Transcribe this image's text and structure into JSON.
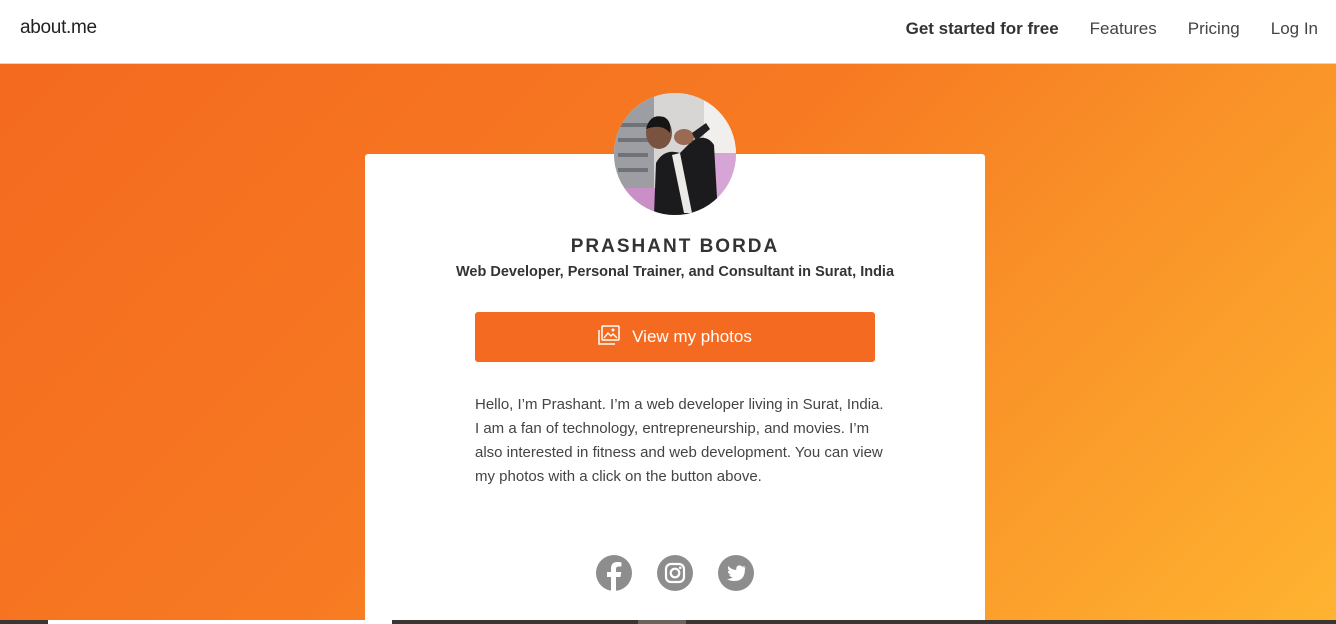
{
  "header": {
    "logo": "about.me",
    "nav": [
      {
        "label": "Get started for free"
      },
      {
        "label": "Features"
      },
      {
        "label": "Pricing"
      },
      {
        "label": "Log In"
      }
    ]
  },
  "profile": {
    "name": "PRASHANT BORDA",
    "tagline": "Web Developer, Personal Trainer, and Consultant in Surat, India",
    "cta_label": "View my photos",
    "cta_icon": "photo-gallery-icon",
    "bio": "Hello, I’m Prashant. I’m a web developer living in Surat, India. I am a fan of technology, entrepreneurship, and movies. I’m also interested in fitness and web development. You can view my photos with a click on the button above.",
    "social": [
      {
        "icon": "facebook-icon"
      },
      {
        "icon": "instagram-icon"
      },
      {
        "icon": "twitter-icon"
      }
    ]
  },
  "colors": {
    "accent": "#f46a21",
    "gradient_start": "#f46a1f",
    "gradient_end": "#ffb330",
    "icon_gray": "#8d8d8d"
  }
}
